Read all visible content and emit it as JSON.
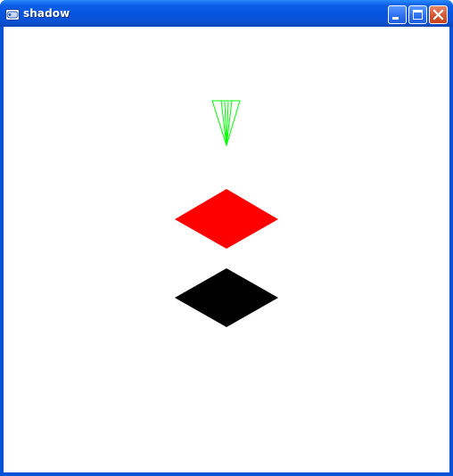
{
  "window": {
    "title": "shadow",
    "controls": {
      "minimize_icon": "minimize-icon",
      "maximize_icon": "maximize-icon",
      "close_icon": "close-icon"
    }
  },
  "scene": {
    "light_color": "#00ff00",
    "object_color": "#ff0000",
    "shadow_color": "#000000",
    "background_color": "#ffffff"
  }
}
